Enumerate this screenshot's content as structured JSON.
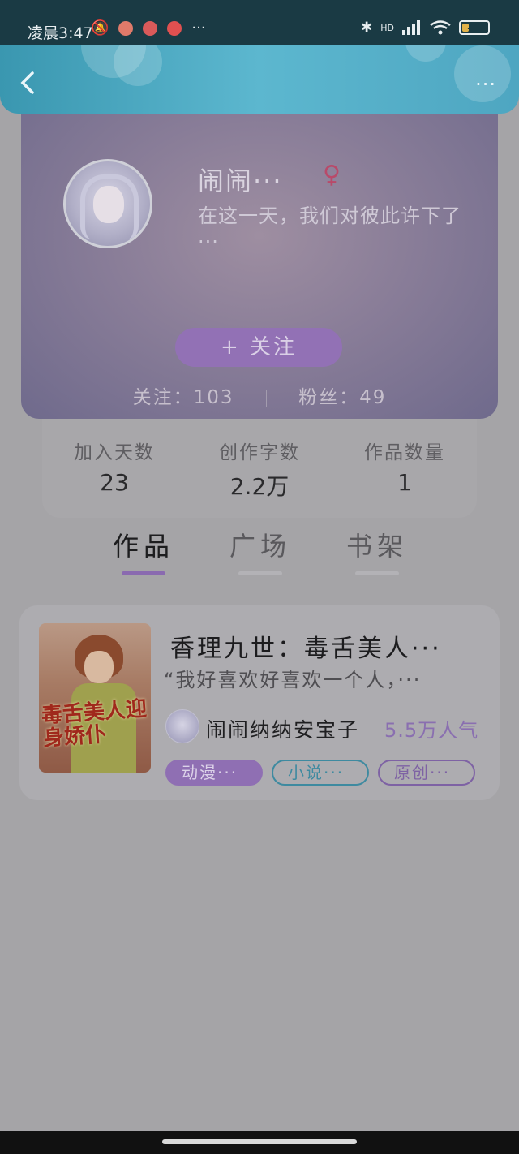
{
  "status_bar": {
    "time": "凌晨3:47",
    "more": "···",
    "network": "HD",
    "battery": "24"
  },
  "header": {
    "back_icon": "chevron-left-icon",
    "more_label": "···"
  },
  "profile": {
    "name": "闹闹···",
    "gender_symbol": "♀",
    "bio": "在这一天，我们对彼此许下了···",
    "follow_button": "+ 关注",
    "following_text": "关注：103",
    "followers_text": "粉丝：49"
  },
  "info": [
    {
      "label": "加入天数",
      "value": "23"
    },
    {
      "label": "创作字数",
      "value": "2.2万"
    },
    {
      "label": "作品数量",
      "value": "1"
    }
  ],
  "tabs": [
    {
      "label": "作品",
      "active": true
    },
    {
      "label": "广场",
      "active": false
    },
    {
      "label": "书架",
      "active": false
    }
  ],
  "work": {
    "title": "香理九世：毒舌美人···",
    "quote": "“我好喜欢好喜欢一个人，···",
    "author": "闹闹纳纳安宝子",
    "popularity": "5.5万人气",
    "cover_title": "毒舌美人迎身娇仆",
    "tags": [
      "动漫···",
      "小说···",
      "原创···"
    ]
  },
  "colors": {
    "accent_purple": "#9271b5",
    "header_blue": "#4ea6c1",
    "tag_blue": "#3e8aa0"
  }
}
